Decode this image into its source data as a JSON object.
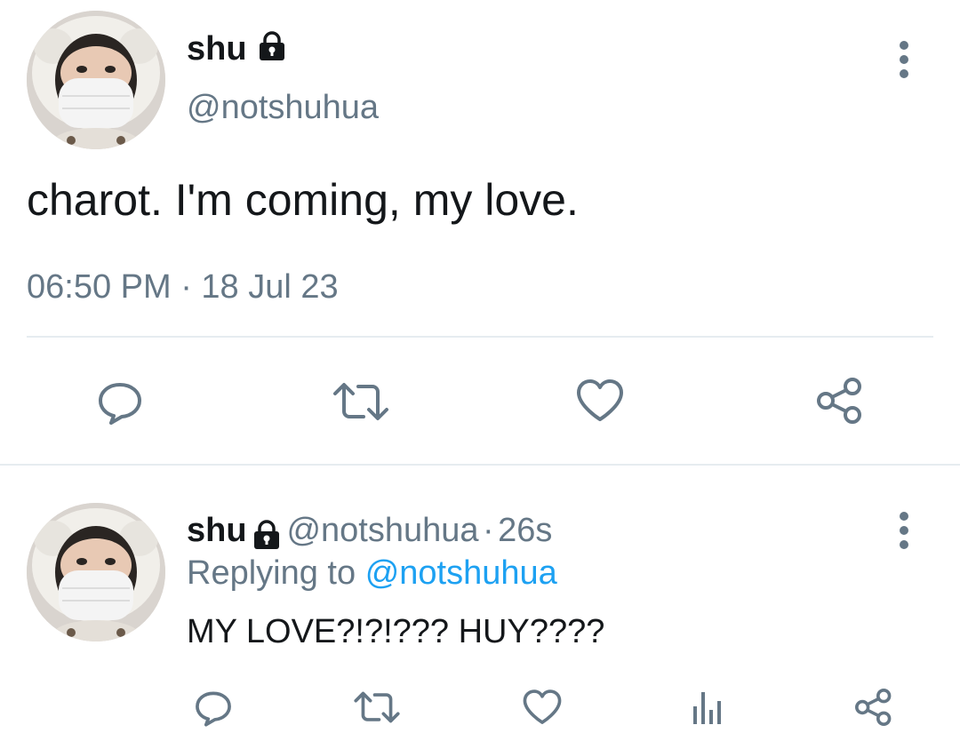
{
  "main_tweet": {
    "author_name": "shu",
    "author_handle": "@notshuhua",
    "text": "charot. I'm coming, my love.",
    "timestamp": "06:50 PM · 18 Jul 23",
    "icons": {
      "verified": "lock-icon",
      "more": "more-vertical-icon",
      "reply": "comment-icon",
      "retweet": "retweet-icon",
      "like": "heart-icon",
      "share": "share-icon"
    }
  },
  "reply_tweet": {
    "author_name": "shu",
    "author_handle": "@notshuhua",
    "time_sep": "·",
    "time_ago": "26s",
    "replying_prefix": "Replying to",
    "replying_to": "@notshuhua",
    "text": "MY LOVE?!?!??? HUY????",
    "icons": {
      "verified": "lock-icon",
      "more": "more-vertical-icon",
      "reply": "comment-icon",
      "retweet": "retweet-icon",
      "like": "heart-icon",
      "analytics": "bar-chart-icon",
      "share": "share-icon"
    }
  },
  "colors": {
    "text_primary": "#14171a",
    "text_secondary": "#657786",
    "link": "#1da1f2",
    "divider": "#e6ecf0"
  }
}
